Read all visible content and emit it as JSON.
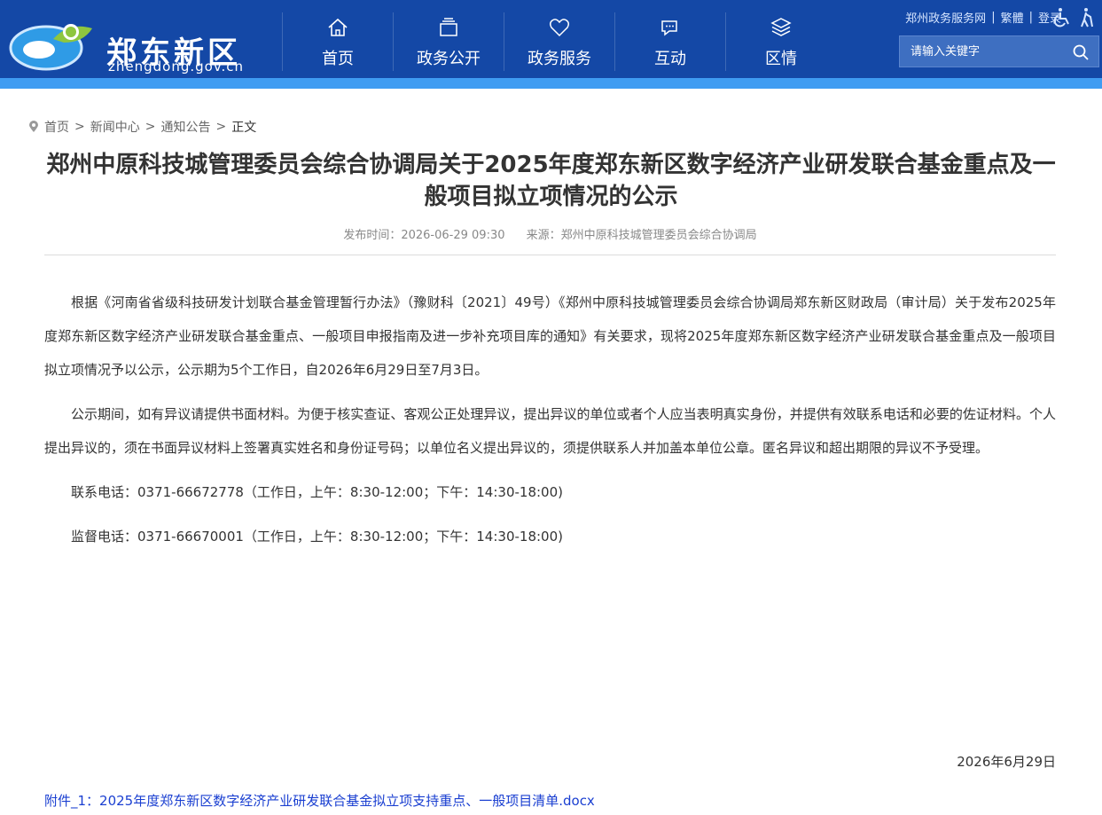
{
  "header": {
    "logo_cn": "郑东新区",
    "logo_en": "zhengdong.gov.cn",
    "nav": [
      {
        "label": "首页",
        "icon": "home-icon"
      },
      {
        "label": "政务公开",
        "icon": "document-stack-icon"
      },
      {
        "label": "政务服务",
        "icon": "heart-icon"
      },
      {
        "label": "互动",
        "icon": "chat-icon"
      },
      {
        "label": "区情",
        "icon": "layers-icon"
      }
    ],
    "toplinks": {
      "service": "郑州政务服务网",
      "traditional": "繁體",
      "login": "登录"
    },
    "search": {
      "placeholder": "请输入关键字"
    }
  },
  "breadcrumb": {
    "home": "首页",
    "news": "新闻中心",
    "notice": "通知公告",
    "current": "正文",
    "separator": ">"
  },
  "article": {
    "title": "郑州中原科技城管理委员会综合协调局关于2025年度郑东新区数字经济产业研发联合基金重点及一般项目拟立项情况的公示",
    "publish_time": "发布时间：2026-06-29 09:30",
    "source": "来源：郑州中原科技城管理委员会综合协调局",
    "paragraphs": [
      "根据《河南省省级科技研发计划联合基金管理暂行办法》（豫财科〔2021〕49号）《郑州中原科技城管理委员会综合协调局郑东新区财政局（审计局）关于发布2025年度郑东新区数字经济产业研发联合基金重点、一般项目申报指南及进一步补充项目库的通知》有关要求，现将2025年度郑东新区数字经济产业研发联合基金重点及一般项目拟立项情况予以公示，公示期为5个工作日，自2026年6月29日至7月3日。",
      "公示期间，如有异议请提供书面材料。为便于核实查证、客观公正处理异议，提出异议的单位或者个人应当表明真实身份，并提供有效联系电话和必要的佐证材料。个人提出异议的，须在书面异议材料上签署真实姓名和身份证号码；以单位名义提出异议的，须提供联系人并加盖本单位公章。匿名异议和超出期限的异议不予受理。",
      "联系电话：0371-66672778（工作日，上午：8:30-12:00；下午：14:30-18:00)",
      "监督电话：0371-66670001（工作日，上午：8:30-12:00；下午：14:30-18:00)"
    ],
    "date_sign": "2026年6月29日",
    "attachment": "附件_1：2025年度郑东新区数字经济产业研发联合基金拟立项支持重点、一般项目清单.docx"
  },
  "colors": {
    "header_bg": "#1448a6",
    "stripe": "#3f9cf2",
    "link": "#1a3fd1"
  }
}
